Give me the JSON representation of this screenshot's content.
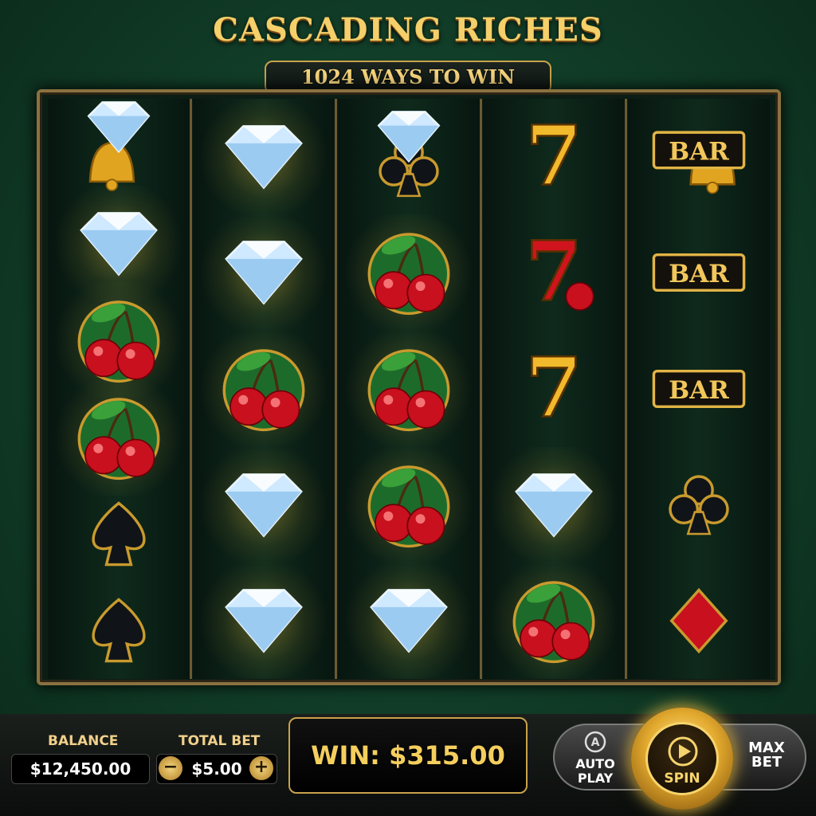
{
  "title": "CASCADING RICHES",
  "subtitle": "1024 WAYS TO WIN",
  "reels": [
    [
      "diamond-bell",
      "diamond",
      "cherry",
      "cherry",
      "spade",
      "spade"
    ],
    [
      "diamond",
      "diamond",
      "cherry",
      "diamond",
      "diamond"
    ],
    [
      "diamond-club",
      "cherry",
      "cherry",
      "cherry",
      "diamond"
    ],
    [
      "seven-gold",
      "seven-red",
      "seven-gold",
      "diamond",
      "cherry"
    ],
    [
      "bar-bell",
      "bar",
      "bar",
      "club",
      "red-diamond"
    ]
  ],
  "bottom": {
    "balance_label": "BALANCE",
    "balance_value": "$12,450.00",
    "bet_label": "TOTAL BET",
    "bet_value": "$5.00",
    "bet_minus": "−",
    "bet_plus": "+",
    "win_text": "WIN: $315.00",
    "auto_play": "AUTO\nPLAY",
    "spin": "SPIN",
    "max_bet": "MAX\nBET"
  },
  "symbols_text": {
    "bar": "BAR",
    "seven": "7"
  },
  "colors": {
    "gold": "#f4cf6a",
    "felt": "#12402a",
    "cherry": "#c8101e"
  }
}
